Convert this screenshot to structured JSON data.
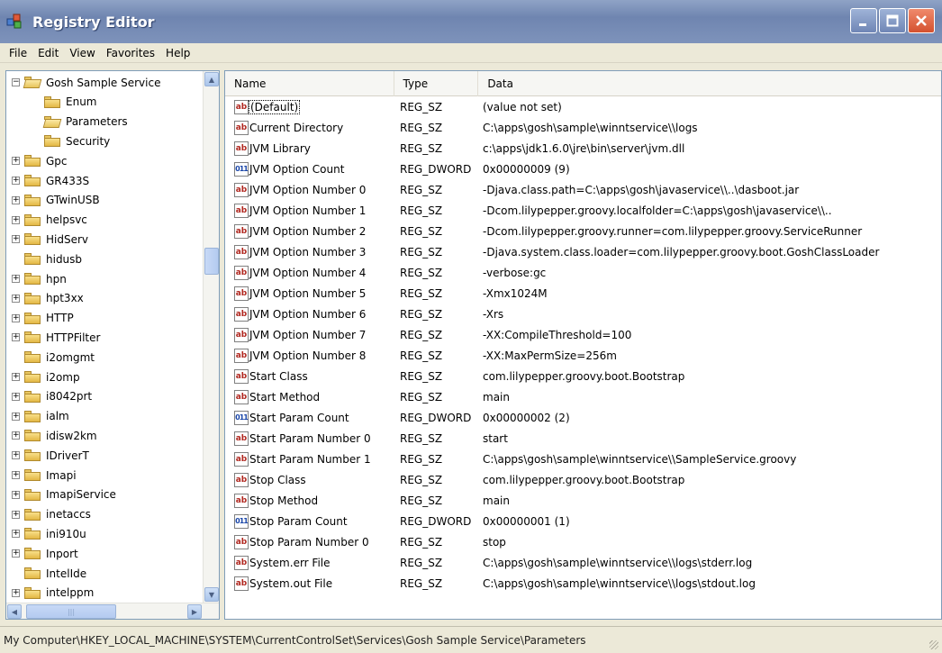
{
  "window": {
    "title": "Registry Editor",
    "icon": "registry-editor-icon",
    "buttons": {
      "minimize": "minimize-icon",
      "maximize": "maximize-icon",
      "close": "close-icon"
    }
  },
  "menu": [
    "File",
    "Edit",
    "View",
    "Favorites",
    "Help"
  ],
  "tree": {
    "items": [
      {
        "label": "Gosh Sample Service",
        "expander": "−",
        "level": 0,
        "open": true
      },
      {
        "label": "Enum",
        "expander": "",
        "level": 1,
        "open": false
      },
      {
        "label": "Parameters",
        "expander": "",
        "level": 1,
        "open": true,
        "selected": true
      },
      {
        "label": "Security",
        "expander": "",
        "level": 1,
        "open": false
      },
      {
        "label": "Gpc",
        "expander": "+",
        "level": 0
      },
      {
        "label": "GR433S",
        "expander": "+",
        "level": 0
      },
      {
        "label": "GTwinUSB",
        "expander": "+",
        "level": 0
      },
      {
        "label": "helpsvc",
        "expander": "+",
        "level": 0
      },
      {
        "label": "HidServ",
        "expander": "+",
        "level": 0
      },
      {
        "label": "hidusb",
        "expander": "",
        "level": 0
      },
      {
        "label": "hpn",
        "expander": "+",
        "level": 0
      },
      {
        "label": "hpt3xx",
        "expander": "+",
        "level": 0
      },
      {
        "label": "HTTP",
        "expander": "+",
        "level": 0
      },
      {
        "label": "HTTPFilter",
        "expander": "+",
        "level": 0
      },
      {
        "label": "i2omgmt",
        "expander": "",
        "level": 0
      },
      {
        "label": "i2omp",
        "expander": "+",
        "level": 0
      },
      {
        "label": "i8042prt",
        "expander": "+",
        "level": 0
      },
      {
        "label": "ialm",
        "expander": "+",
        "level": 0
      },
      {
        "label": "idisw2km",
        "expander": "+",
        "level": 0
      },
      {
        "label": "IDriverT",
        "expander": "+",
        "level": 0
      },
      {
        "label": "Imapi",
        "expander": "+",
        "level": 0
      },
      {
        "label": "ImapiService",
        "expander": "+",
        "level": 0
      },
      {
        "label": "inetaccs",
        "expander": "+",
        "level": 0
      },
      {
        "label": "ini910u",
        "expander": "+",
        "level": 0
      },
      {
        "label": "Inport",
        "expander": "+",
        "level": 0
      },
      {
        "label": "IntelIde",
        "expander": "",
        "level": 0
      },
      {
        "label": "intelppm",
        "expander": "+",
        "level": 0
      }
    ]
  },
  "list": {
    "columns": [
      "Name",
      "Type",
      "Data"
    ],
    "rows": [
      {
        "name": "(Default)",
        "type": "REG_SZ",
        "data": "(value not set)",
        "icon": "ab"
      },
      {
        "name": "Current Directory",
        "type": "REG_SZ",
        "data": "C:\\apps\\gosh\\sample\\winntservice\\\\logs",
        "icon": "ab"
      },
      {
        "name": "JVM Library",
        "type": "REG_SZ",
        "data": "c:\\apps\\jdk1.6.0\\jre\\bin\\server\\jvm.dll",
        "icon": "ab"
      },
      {
        "name": "JVM Option Count",
        "type": "REG_DWORD",
        "data": "0x00000009 (9)",
        "icon": "dword"
      },
      {
        "name": "JVM Option Number 0",
        "type": "REG_SZ",
        "data": "-Djava.class.path=C:\\apps\\gosh\\javaservice\\\\..\\dasboot.jar",
        "icon": "ab"
      },
      {
        "name": "JVM Option Number 1",
        "type": "REG_SZ",
        "data": "-Dcom.lilypepper.groovy.localfolder=C:\\apps\\gosh\\javaservice\\\\..",
        "icon": "ab"
      },
      {
        "name": "JVM Option Number 2",
        "type": "REG_SZ",
        "data": "-Dcom.lilypepper.groovy.runner=com.lilypepper.groovy.ServiceRunner",
        "icon": "ab"
      },
      {
        "name": "JVM Option Number 3",
        "type": "REG_SZ",
        "data": "-Djava.system.class.loader=com.lilypepper.groovy.boot.GoshClassLoader",
        "icon": "ab"
      },
      {
        "name": "JVM Option Number 4",
        "type": "REG_SZ",
        "data": "-verbose:gc",
        "icon": "ab"
      },
      {
        "name": "JVM Option Number 5",
        "type": "REG_SZ",
        "data": "-Xmx1024M",
        "icon": "ab"
      },
      {
        "name": "JVM Option Number 6",
        "type": "REG_SZ",
        "data": "-Xrs",
        "icon": "ab"
      },
      {
        "name": "JVM Option Number 7",
        "type": "REG_SZ",
        "data": "-XX:CompileThreshold=100",
        "icon": "ab"
      },
      {
        "name": "JVM Option Number 8",
        "type": "REG_SZ",
        "data": "-XX:MaxPermSize=256m",
        "icon": "ab"
      },
      {
        "name": "Start Class",
        "type": "REG_SZ",
        "data": "com.lilypepper.groovy.boot.Bootstrap",
        "icon": "ab"
      },
      {
        "name": "Start Method",
        "type": "REG_SZ",
        "data": "main",
        "icon": "ab"
      },
      {
        "name": "Start Param Count",
        "type": "REG_DWORD",
        "data": "0x00000002 (2)",
        "icon": "dword"
      },
      {
        "name": "Start Param Number 0",
        "type": "REG_SZ",
        "data": "start",
        "icon": "ab"
      },
      {
        "name": "Start Param Number 1",
        "type": "REG_SZ",
        "data": "C:\\apps\\gosh\\sample\\winntservice\\\\SampleService.groovy",
        "icon": "ab"
      },
      {
        "name": "Stop Class",
        "type": "REG_SZ",
        "data": "com.lilypepper.groovy.boot.Bootstrap",
        "icon": "ab"
      },
      {
        "name": "Stop Method",
        "type": "REG_SZ",
        "data": "main",
        "icon": "ab"
      },
      {
        "name": "Stop Param Count",
        "type": "REG_DWORD",
        "data": "0x00000001 (1)",
        "icon": "dword"
      },
      {
        "name": "Stop Param Number 0",
        "type": "REG_SZ",
        "data": "stop",
        "icon": "ab"
      },
      {
        "name": "System.err File",
        "type": "REG_SZ",
        "data": "C:\\apps\\gosh\\sample\\winntservice\\\\logs\\stderr.log",
        "icon": "ab"
      },
      {
        "name": "System.out File",
        "type": "REG_SZ",
        "data": "C:\\apps\\gosh\\sample\\winntservice\\\\logs\\stdout.log",
        "icon": "ab"
      }
    ],
    "icon_text": {
      "ab": "ab",
      "dword": "011"
    }
  },
  "status": "My Computer\\HKEY_LOCAL_MACHINE\\SYSTEM\\CurrentControlSet\\Services\\Gosh Sample Service\\Parameters"
}
